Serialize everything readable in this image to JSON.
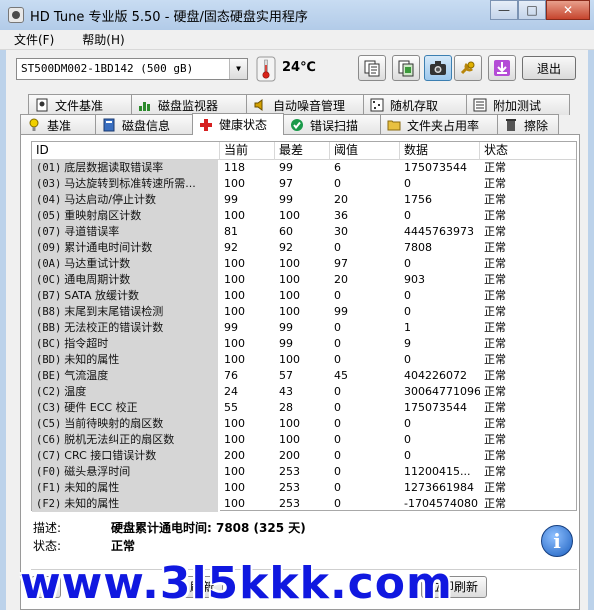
{
  "window": {
    "title": "HD Tune 专业版 5.50 - 硬盘/固态硬盘实用程序",
    "minimize": "—",
    "maximize": "□",
    "close": "✕"
  },
  "menu": [
    {
      "label": "文件(F)"
    },
    {
      "label": "帮助(H)"
    }
  ],
  "toolbar": {
    "drive": "ST500DM002-1BD142 (500 gB)",
    "temperature": "24℃",
    "exit_label": "退出",
    "buttons": [
      "copy-text-icon",
      "copy-screenshot-icon",
      "camera-icon",
      "options-icon",
      "download-icon"
    ]
  },
  "tabs_row1": [
    {
      "label": "文件基准",
      "icon": "file-benchmark-icon"
    },
    {
      "label": "磁盘监视器",
      "icon": "disk-monitor-icon"
    },
    {
      "label": "自动噪音管理",
      "icon": "speaker-icon"
    },
    {
      "label": "随机存取",
      "icon": "random-access-icon"
    },
    {
      "label": "附加测试",
      "icon": "extra-tests-icon"
    }
  ],
  "tabs_row2": [
    {
      "label": "基准",
      "icon": "benchmark-icon"
    },
    {
      "label": "磁盘信息",
      "icon": "disk-info-icon"
    },
    {
      "label": "健康状态",
      "icon": "health-cross-icon",
      "active": true
    },
    {
      "label": "错误扫描",
      "icon": "error-scan-icon"
    },
    {
      "label": "文件夹占用率",
      "icon": "folder-usage-icon"
    },
    {
      "label": "擦除",
      "icon": "erase-icon"
    }
  ],
  "table": {
    "headers": [
      "ID",
      "当前",
      "最差",
      "阈值",
      "数据",
      "状态"
    ],
    "rows": [
      {
        "code": "(01)",
        "name": "底层数据读取错误率",
        "current": "118",
        "worst": "99",
        "threshold": "6",
        "data": "175073544",
        "status": "正常"
      },
      {
        "code": "(03)",
        "name": "马达旋转到标准转速所需...",
        "current": "100",
        "worst": "97",
        "threshold": "0",
        "data": "0",
        "status": "正常"
      },
      {
        "code": "(04)",
        "name": "马达启动/停止计数",
        "current": "99",
        "worst": "99",
        "threshold": "20",
        "data": "1756",
        "status": "正常"
      },
      {
        "code": "(05)",
        "name": "重映射扇区计数",
        "current": "100",
        "worst": "100",
        "threshold": "36",
        "data": "0",
        "status": "正常"
      },
      {
        "code": "(07)",
        "name": "寻道错误率",
        "current": "81",
        "worst": "60",
        "threshold": "30",
        "data": "4445763973",
        "status": "正常"
      },
      {
        "code": "(09)",
        "name": "累计通电时间计数",
        "current": "92",
        "worst": "92",
        "threshold": "0",
        "data": "7808",
        "status": "正常"
      },
      {
        "code": "(0A)",
        "name": "马达重试计数",
        "current": "100",
        "worst": "100",
        "threshold": "97",
        "data": "0",
        "status": "正常"
      },
      {
        "code": "(0C)",
        "name": "通电周期计数",
        "current": "100",
        "worst": "100",
        "threshold": "20",
        "data": "903",
        "status": "正常"
      },
      {
        "code": "(B7)",
        "name": "SATA 放缓计数",
        "current": "100",
        "worst": "100",
        "threshold": "0",
        "data": "0",
        "status": "正常"
      },
      {
        "code": "(B8)",
        "name": "末尾到末尾错误检测",
        "current": "100",
        "worst": "100",
        "threshold": "99",
        "data": "0",
        "status": "正常"
      },
      {
        "code": "(BB)",
        "name": "无法校正的错误计数",
        "current": "99",
        "worst": "99",
        "threshold": "0",
        "data": "1",
        "status": "正常"
      },
      {
        "code": "(BC)",
        "name": "指令超时",
        "current": "100",
        "worst": "99",
        "threshold": "0",
        "data": "9",
        "status": "正常"
      },
      {
        "code": "(BD)",
        "name": "未知的属性",
        "current": "100",
        "worst": "100",
        "threshold": "0",
        "data": "0",
        "status": "正常"
      },
      {
        "code": "(BE)",
        "name": "气流温度",
        "current": "76",
        "worst": "57",
        "threshold": "45",
        "data": "404226072",
        "status": "正常"
      },
      {
        "code": "(C2)",
        "name": "温度",
        "current": "24",
        "worst": "43",
        "threshold": "0",
        "data": "30064771096",
        "status": "正常"
      },
      {
        "code": "(C3)",
        "name": "硬件 ECC 校正",
        "current": "55",
        "worst": "28",
        "threshold": "0",
        "data": "175073544",
        "status": "正常"
      },
      {
        "code": "(C5)",
        "name": "当前待映射的扇区数",
        "current": "100",
        "worst": "100",
        "threshold": "0",
        "data": "0",
        "status": "正常"
      },
      {
        "code": "(C6)",
        "name": "脱机无法纠正的扇区数",
        "current": "100",
        "worst": "100",
        "threshold": "0",
        "data": "0",
        "status": "正常"
      },
      {
        "code": "(C7)",
        "name": "CRC 接口错误计数",
        "current": "200",
        "worst": "200",
        "threshold": "0",
        "data": "0",
        "status": "正常"
      },
      {
        "code": "(F0)",
        "name": "磁头悬浮时间",
        "current": "100",
        "worst": "253",
        "threshold": "0",
        "data": "11200415...",
        "status": "正常"
      },
      {
        "code": "(F1)",
        "name": "未知的属性",
        "current": "100",
        "worst": "253",
        "threshold": "0",
        "data": "1273661984",
        "status": "正常"
      },
      {
        "code": "(F2)",
        "name": "未知的属性",
        "current": "100",
        "worst": "253",
        "threshold": "0",
        "data": "-1704574080",
        "status": "正常"
      }
    ]
  },
  "details": {
    "desc_label": "描述:",
    "desc_value": "硬盘累计通电时间: 7808 (325 天)",
    "status_label": "状态:",
    "status_value": "正常"
  },
  "bottom": {
    "left_label": "健",
    "middle_label": "刷新",
    "right_label": "立即刷新"
  },
  "watermark": "www.3l5kkk.com"
}
